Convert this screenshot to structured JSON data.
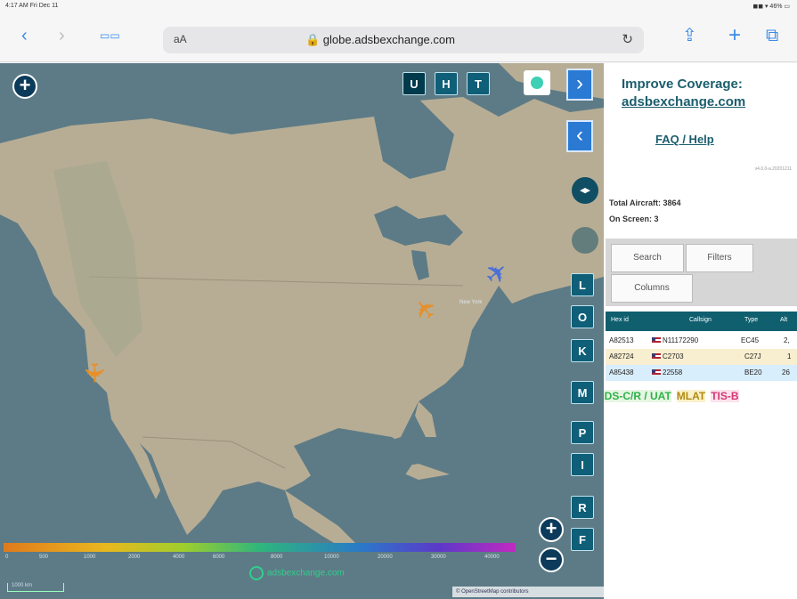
{
  "status": {
    "time": "4:17 AM  Fri Dec 11",
    "right": "◼◼ ▾ 46% ▭"
  },
  "safari": {
    "back": "‹",
    "forward": "›",
    "book": "▭▭",
    "text_size": "aA",
    "url": "🔒 globe.adsbexchange.com",
    "reload": "↻",
    "share": "⇪",
    "new_tab": "+",
    "tabs": "⧉"
  },
  "map": {
    "zoom_plus": "+",
    "zoom_minus": "−",
    "top_plus": "+",
    "map_buttons": [
      "U",
      "H",
      "T"
    ],
    "side_buttons": [
      "L",
      "O",
      "K",
      "M",
      "P",
      "I",
      "R",
      "F"
    ],
    "expand": "›",
    "collapse": "‹",
    "resize": "◂▸",
    "gradient_labels": [
      "0",
      "500",
      "1000",
      "2000",
      "4000",
      "6000",
      "8000",
      "10000",
      "20000",
      "30000",
      "40000"
    ],
    "watermark": "adsbexchange.com",
    "attribution": "© OpenStreetMap contributors",
    "scale": "1000 km",
    "ny_label": "New York"
  },
  "panel": {
    "title_line1": "Improve Coverage:",
    "title_line2": "adsbexchange.com",
    "faq": "FAQ / Help",
    "version": "v4.0.0-a.20201211",
    "total_aircraft": "Total Aircraft: 3864",
    "on_screen": "On Screen: 3",
    "tabs": [
      "Search",
      "Filters",
      "Columns"
    ],
    "columns": [
      "Hex id",
      "",
      "Callsign",
      "Type",
      "Alt"
    ],
    "rows": [
      {
        "hex": "A82513",
        "callsign": "N11172290",
        "type": "EC45",
        "alt": "2,",
        "bg": "#ffffff"
      },
      {
        "hex": "A82724",
        "callsign": "C2703",
        "type": "C27J",
        "alt": "1",
        "bg": "#f8eed0"
      },
      {
        "hex": "A85438",
        "callsign": "22558",
        "type": "BE20",
        "alt": "26",
        "bg": "#d9eefc"
      }
    ],
    "legend": [
      {
        "label": "ADS-C/R / UAT",
        "color": "#2fb24a"
      },
      {
        "label": "MLAT",
        "color": "#c49a1a"
      },
      {
        "label": "TIS-B",
        "color": "#d43a74"
      }
    ]
  },
  "colors": {
    "map_water": "#5f7d88",
    "land": "#b6ae96",
    "panel_accent": "#1b5e6d",
    "button_teal": "#0f5f78"
  }
}
